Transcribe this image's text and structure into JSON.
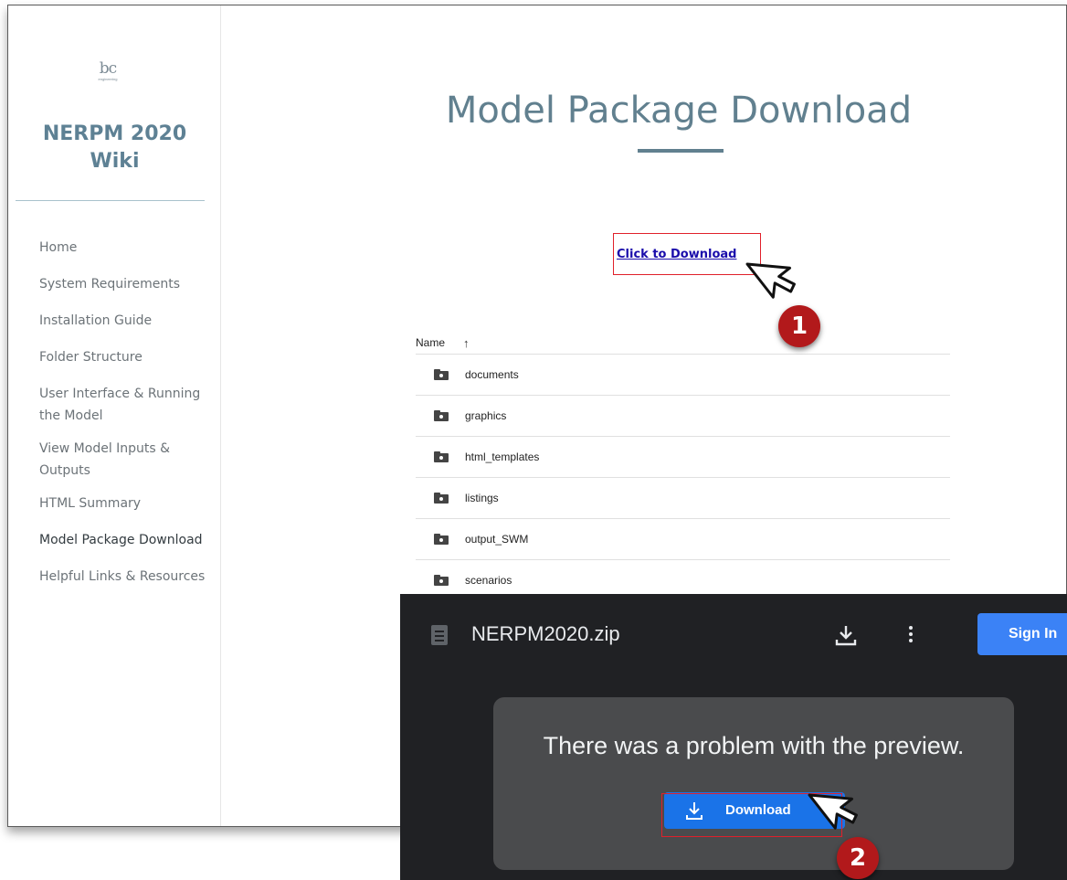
{
  "sidebar": {
    "logo_mark": "bc",
    "logo_sub": "engineering",
    "wiki_title_line1": "NERPM 2020",
    "wiki_title_line2": "Wiki",
    "items": [
      {
        "label": "Home"
      },
      {
        "label": "System Requirements"
      },
      {
        "label": "Installation Guide"
      },
      {
        "label": "Folder Structure"
      },
      {
        "label": "User Interface & Running the Model"
      },
      {
        "label": "View Model Inputs & Outputs"
      },
      {
        "label": "HTML Summary"
      },
      {
        "label": "Model Package Download"
      },
      {
        "label": "Helpful Links & Resources"
      }
    ],
    "active_item": "Model Package Download"
  },
  "main": {
    "title": "Model Package Download",
    "download_link": "Click to Download",
    "files": {
      "column_name": "Name",
      "sort_arrow": "↑",
      "folders": [
        "documents",
        "graphics",
        "html_templates",
        "listings",
        "output_SWM",
        "scenarios"
      ]
    }
  },
  "steps": {
    "step1": "1",
    "step2": "2"
  },
  "preview": {
    "file_name": "NERPM2020.zip",
    "sign_in": "Sign In",
    "message": "There was a problem with the preview.",
    "download_button": "Download"
  },
  "colors": {
    "accent": "#61808f",
    "link": "#1a0dab",
    "highlight_box": "#e0202a",
    "step_badge": "#b2191b",
    "preview_bg": "#202124",
    "google_blue": "#1a73e8"
  }
}
